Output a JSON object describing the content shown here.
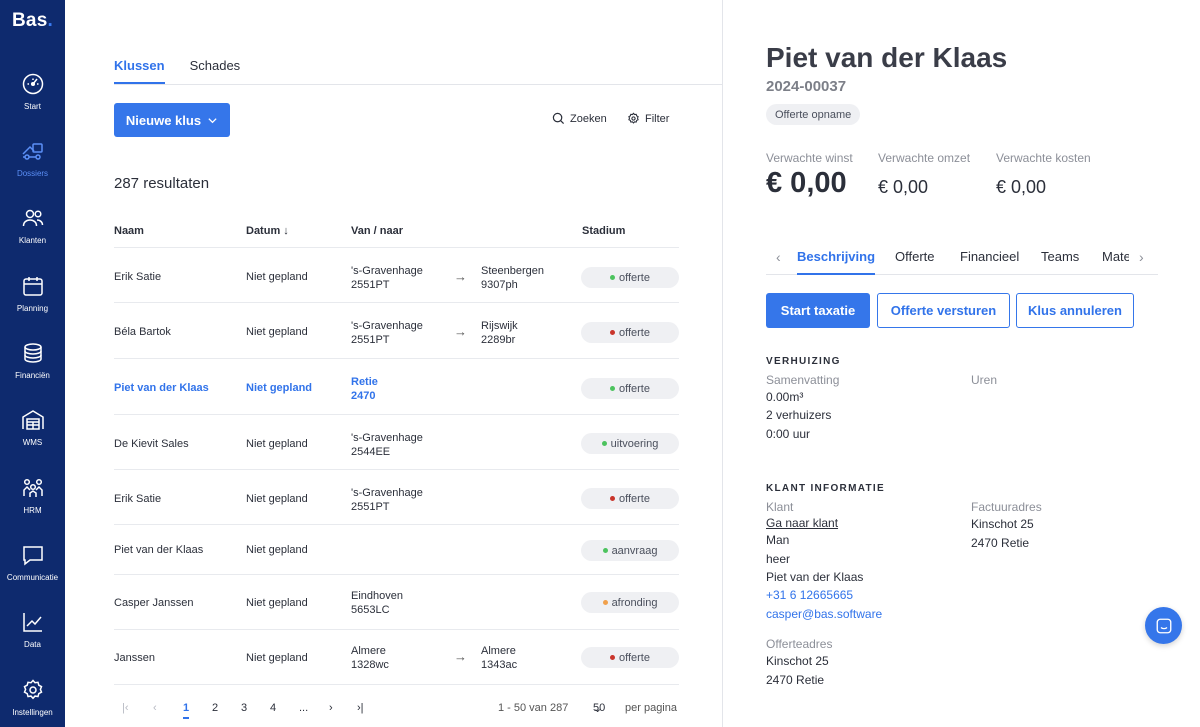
{
  "app": {
    "logo": "Bas",
    "logo_dot": "."
  },
  "sidebar": {
    "items": [
      {
        "label": "Start",
        "icon": "gauge-icon",
        "active": false
      },
      {
        "label": "Dossiers",
        "icon": "truck-icon",
        "active": true
      },
      {
        "label": "Klanten",
        "icon": "users-icon",
        "active": false
      },
      {
        "label": "Planning",
        "icon": "calendar-icon",
        "active": false
      },
      {
        "label": "Financiën",
        "icon": "coins-icon",
        "active": false
      },
      {
        "label": "WMS",
        "icon": "warehouse-icon",
        "active": false
      },
      {
        "label": "HRM",
        "icon": "people-icon",
        "active": false
      },
      {
        "label": "Communicatie",
        "icon": "chat-icon",
        "active": false
      },
      {
        "label": "Data",
        "icon": "chart-line-icon",
        "active": false
      },
      {
        "label": "Instellingen",
        "icon": "gear-icon",
        "active": false
      }
    ]
  },
  "list": {
    "tabs": [
      {
        "label": "Klussen",
        "active": true
      },
      {
        "label": "Schades",
        "active": false
      }
    ],
    "new_button": "Nieuwe klus",
    "search_label": "Zoeken",
    "filter_label": "Filter",
    "results": "287 resultaten",
    "columns": {
      "name": "Naam",
      "date": "Datum",
      "route": "Van / naar",
      "stage": "Stadium"
    },
    "rows": [
      {
        "name": "Erik Satie",
        "date": "Niet gepland",
        "from": [
          "'s-Gravenhage",
          "2551PT"
        ],
        "to": [
          "Steenbergen",
          "9307ph"
        ],
        "stage": "offerte",
        "stage_color": "#4cc35e"
      },
      {
        "name": "Béla Bartok",
        "date": "Niet gepland",
        "from": [
          "'s-Gravenhage",
          "2551PT"
        ],
        "to": [
          "Rijswijk",
          "2289br"
        ],
        "stage": "offerte",
        "stage_color": "#c9352b"
      },
      {
        "name": "Piet van der Klaas",
        "date": "Niet gepland",
        "from": [
          "Retie",
          "2470"
        ],
        "to": [],
        "stage": "offerte",
        "stage_color": "#4cc35e",
        "selected": true
      },
      {
        "name": "De Kievit Sales",
        "date": "Niet gepland",
        "from": [
          "'s-Gravenhage",
          "2544EE"
        ],
        "to": [],
        "stage": "uitvoering",
        "stage_color": "#4cc35e"
      },
      {
        "name": "Erik Satie",
        "date": "Niet gepland",
        "from": [
          "'s-Gravenhage",
          "2551PT"
        ],
        "to": [],
        "stage": "offerte",
        "stage_color": "#c9352b"
      },
      {
        "name": "Piet van der Klaas",
        "date": "Niet gepland",
        "from": [],
        "to": [],
        "stage": "aanvraag",
        "stage_color": "#4cc35e"
      },
      {
        "name": "Casper Janssen",
        "date": "Niet gepland",
        "from": [
          "Eindhoven",
          "5653LC"
        ],
        "to": [],
        "stage": "afronding",
        "stage_color": "#f0a04b"
      },
      {
        "name": "Janssen",
        "date": "Niet gepland",
        "from": [
          "Almere",
          "1328wc"
        ],
        "to": [
          "Almere",
          "1343ac"
        ],
        "stage": "offerte",
        "stage_color": "#c9352b"
      }
    ],
    "pagination": {
      "pages": [
        "1",
        "2",
        "3",
        "4",
        "..."
      ],
      "current": "1",
      "range": "1 - 50 van 287",
      "per_page": "50",
      "per_page_label": "per pagina"
    }
  },
  "detail": {
    "title": "Piet van der Klaas",
    "number": "2024-00037",
    "stage": "Offerte opname",
    "metrics": [
      {
        "label": "Verwachte winst",
        "value": "€ 0,00"
      },
      {
        "label": "Verwachte omzet",
        "value": "€ 0,00"
      },
      {
        "label": "Verwachte kosten",
        "value": "€ 0,00"
      }
    ],
    "tabs": [
      "Beschrijving",
      "Offerte",
      "Financieel",
      "Teams",
      "Mate"
    ],
    "actions": {
      "start": "Start taxatie",
      "send": "Offerte versturen",
      "cancel": "Klus annuleren"
    },
    "verhuizing": {
      "title": "VERHUIZING",
      "summary_label": "Samenvatting",
      "volume": "0.00m³",
      "movers": "2 verhuizers",
      "duration": "0:00 uur",
      "hours_label": "Uren"
    },
    "klant": {
      "title": "KLANT INFORMATIE",
      "client_label": "Klant",
      "client_link": "Ga naar klant",
      "gender": "Man",
      "salutation": "heer",
      "name": "Piet van der Klaas",
      "phone": "+31 6 12665665",
      "email": "casper@bas.software",
      "quote_address_label": "Offerteadres",
      "quote_street": "Kinschot 25",
      "quote_city": "2470 Retie",
      "invoice_address_label": "Factuuradres",
      "invoice_street": "Kinschot 25",
      "invoice_city": "2470 Retie"
    }
  }
}
